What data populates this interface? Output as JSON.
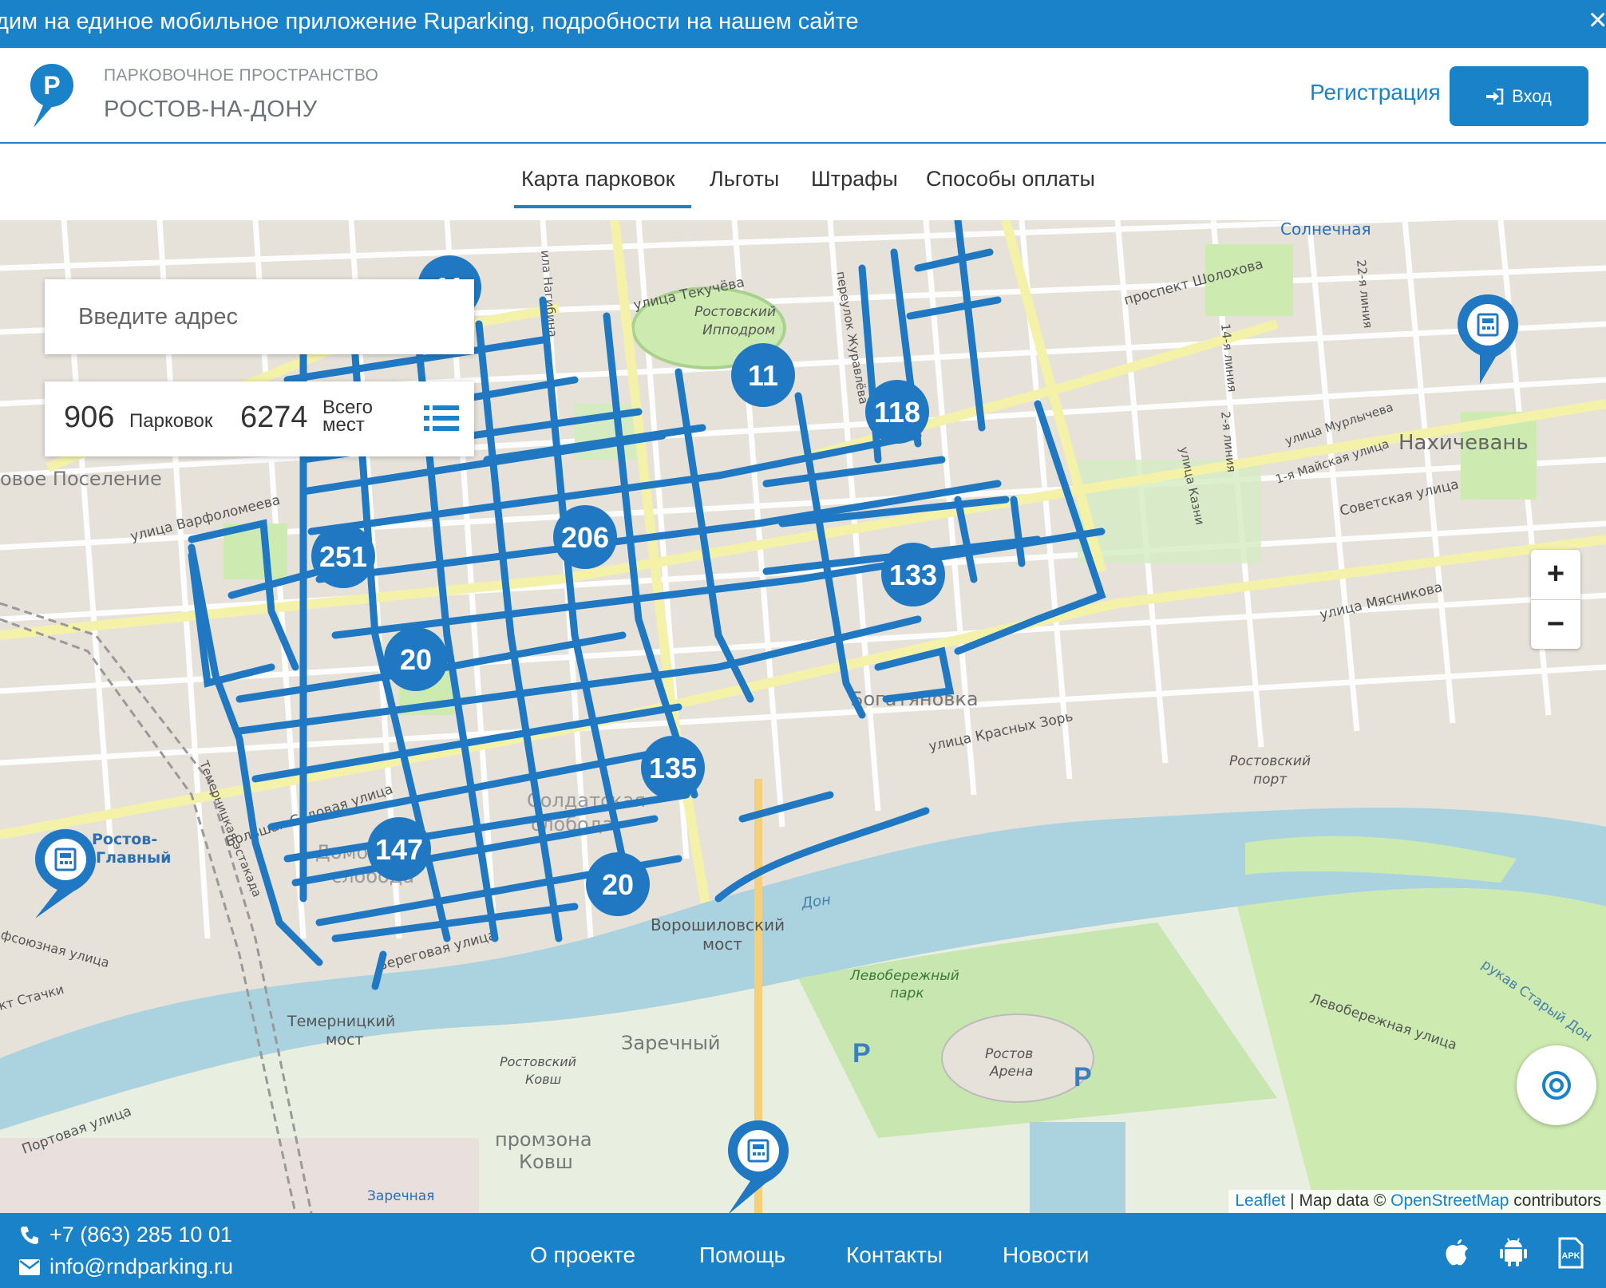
{
  "banner": {
    "text": "дим на единое мобильное приложение Ruparking, подробности на нашем сайте",
    "close": "×"
  },
  "header": {
    "subtitle": "ПАРКОВОЧНОЕ ПРОСТРАНСТВО",
    "city": "РОСТОВ-НА-ДОНУ",
    "register_label": "Регистрация",
    "login_label": "Вход",
    "logo_letter": "P"
  },
  "nav": {
    "items": [
      "Карта парковок",
      "Льготы",
      "Штрафы",
      "Способы оплаты"
    ],
    "active": "Карта парковок"
  },
  "map": {
    "search_placeholder": "Введите адрес",
    "stats": {
      "parkings_count": "906",
      "parkings_label": "Парковок",
      "spaces_count": "6274",
      "spaces_label": "Всего мест"
    },
    "clusters": [
      "11",
      "11",
      "118",
      "251",
      "206",
      "133",
      "20",
      "135",
      "147",
      "20"
    ],
    "zoom_in": "+",
    "zoom_out": "−",
    "attribution": {
      "leaflet": "Leaflet",
      "separator": " | Map data © ",
      "osm": "OpenStreetMap",
      "suffix": " contributors"
    },
    "place_labels": [
      "Солнечная",
      "проспект Шолохова",
      "улица Текучёва",
      "Ростовский Ипподром",
      "Нахичевань",
      "Советская улица",
      "улица Мясникова",
      "Богатяновка",
      "улица Красных Зорь",
      "Ростовский порт",
      "Дон",
      "Ворошиловский мост",
      "Левобережный парк",
      "Ростов Арена",
      "Заречный",
      "Темерницкий мост",
      "промзона Ковш",
      "Ростовский Ковш",
      "Ростов-Главный",
      "Новое Поселение",
      "улица Варфоломеева",
      "Большая Садовая улица",
      "Портовая улица",
      "улица Мурлычева",
      "1-я Майская улица",
      "улица Казни",
      "Левобережная улица",
      "рукав Старый Дон",
      "Заречная",
      "Береговая улица",
      "ила Нагибина",
      "переулок Журавлёва",
      "Солдатская слобода",
      "Домовая слобода",
      "Профсоюзная улица",
      "улица Стачки",
      "Темерницкая эстакада"
    ]
  },
  "footer": {
    "phone": "+7 (863) 285 10 01",
    "email": "info@rndparking.ru",
    "links": [
      "О проекте",
      "Помощь",
      "Контакты",
      "Новости"
    ],
    "apps": [
      "apple-icon",
      "android-icon",
      "apk-icon"
    ],
    "apk_label": "APK"
  },
  "colors": {
    "primary": "#1a82c8",
    "parking_line": "#1f78c1",
    "water": "#aad3df",
    "park": "#cdebb0",
    "road_major": "#f7fabf"
  }
}
